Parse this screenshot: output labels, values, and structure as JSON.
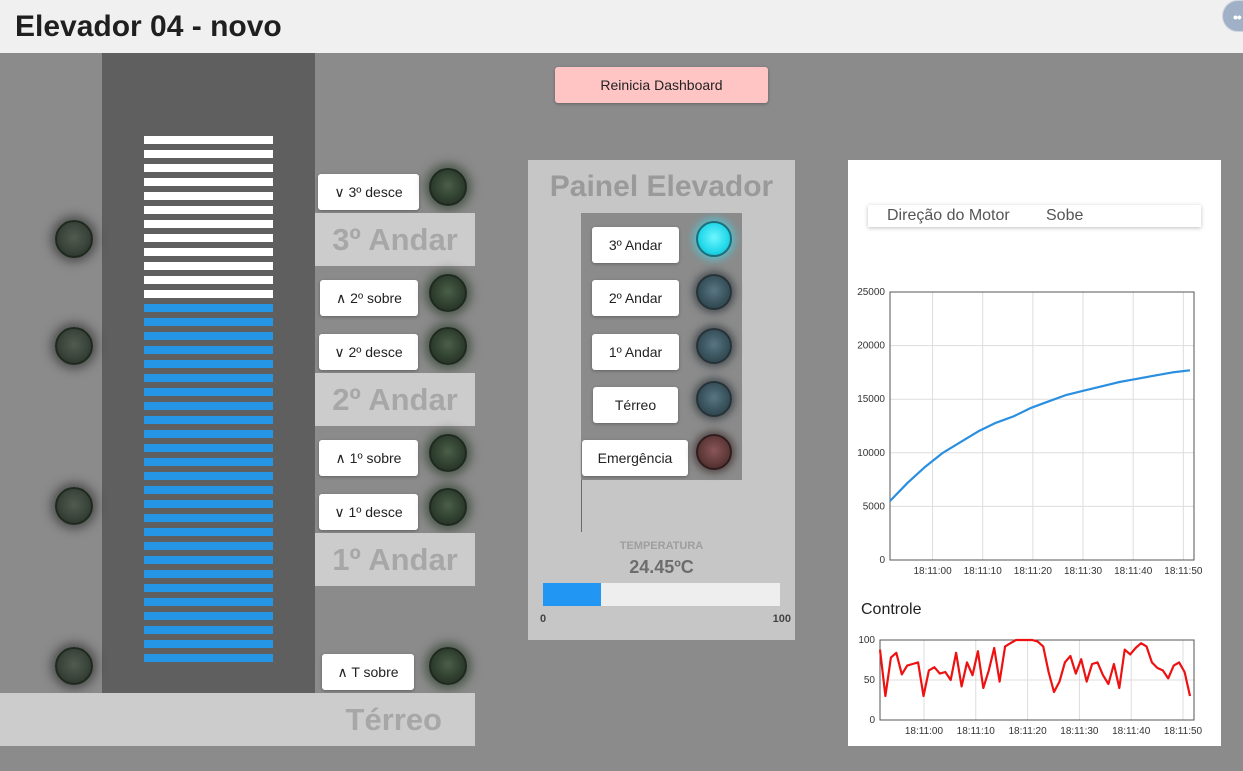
{
  "header": {
    "title": "Elevador 04 - novo",
    "menu_icon": "more-dots-icon"
  },
  "reset_button": "Reinicia Dashboard",
  "calls": {
    "third_down": "∨ 3º desce",
    "second_up": "∧ 2º sobre",
    "second_down": "∨ 2º desce",
    "first_up": "∧ 1º sobre",
    "first_down": "∨ 1º desce",
    "ground_up": "∧ T sobre"
  },
  "floors": {
    "third": "3º Andar",
    "second": "2º Andar",
    "first": "1º Andar",
    "ground": "Térreo"
  },
  "shaft": {
    "white_bars": 12,
    "blue_bars": 26,
    "blue_color": "#2596e6"
  },
  "panel": {
    "title": "Painel Elevador",
    "buttons": [
      "3º Andar",
      "2º Andar",
      "1º Andar",
      "Térreo",
      "Emergência"
    ],
    "lights": [
      "on-cyan",
      "off",
      "off",
      "off",
      "off-red"
    ]
  },
  "temperature": {
    "label": "TEMPERATURA",
    "value": "24.45ºC",
    "numeric": 24.45,
    "min": "0",
    "max": "100"
  },
  "motor": {
    "label": "Direção do Motor",
    "value": "Sobe"
  },
  "chart_data": [
    {
      "type": "line",
      "title": "",
      "x": [
        "18:11:00",
        "18:11:10",
        "18:11:20",
        "18:11:30",
        "18:11:40",
        "18:11:50"
      ],
      "ylim": [
        0,
        25000
      ],
      "yticks": [
        "0",
        "5000",
        "10000",
        "15000",
        "20000",
        "25000"
      ],
      "grid": true,
      "color": "#2a8fe0",
      "values": [
        5500,
        7200,
        8700,
        10000,
        11000,
        12000,
        12800,
        13400,
        14200,
        14800,
        15400,
        15800,
        16200,
        16600,
        16900,
        17200,
        17500,
        17700
      ]
    },
    {
      "type": "line",
      "title": "Controle",
      "x": [
        "18:11:00",
        "18:11:10",
        "18:11:20",
        "18:11:30",
        "18:11:40",
        "18:11:50"
      ],
      "ylim": [
        0,
        100
      ],
      "yticks": [
        "0",
        "50",
        "100"
      ],
      "grid": true,
      "color": "#ee1111",
      "values": [
        88,
        30,
        78,
        84,
        57,
        68,
        70,
        72,
        30,
        62,
        66,
        58,
        60,
        50,
        84,
        42,
        72,
        56,
        86,
        40,
        62,
        90,
        48,
        92,
        96,
        100,
        100,
        100,
        100,
        98,
        92,
        60,
        35,
        48,
        72,
        80,
        58,
        76,
        48,
        70,
        72,
        56,
        45,
        70,
        40,
        88,
        82,
        90,
        96,
        92,
        72,
        65,
        62,
        52,
        68,
        72,
        60,
        30
      ]
    }
  ]
}
